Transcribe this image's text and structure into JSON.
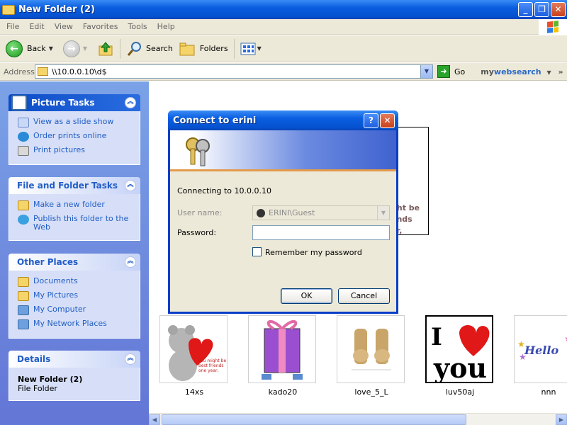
{
  "window": {
    "title": "New Folder (2)"
  },
  "menu": [
    "File",
    "Edit",
    "View",
    "Favorites",
    "Tools",
    "Help"
  ],
  "toolbar": {
    "back_label": "Back",
    "search_label": "Search",
    "folders_label": "Folders"
  },
  "address": {
    "label": "Address",
    "value": "\\\\10.0.0.10\\d$",
    "go_label": "Go",
    "websearch_prefix": "my",
    "websearch_brand": "websearch"
  },
  "left_pane": {
    "picture_tasks": {
      "title": "Picture Tasks",
      "items": [
        "View as a slide show",
        "Order prints online",
        "Print pictures"
      ]
    },
    "file_folder_tasks": {
      "title": "File and Folder Tasks",
      "items": [
        "Make a new folder",
        "Publish this folder to the Web"
      ]
    },
    "other_places": {
      "title": "Other Places",
      "items": [
        "Documents",
        "My Pictures",
        "My Computer",
        "My Network Places"
      ]
    },
    "details": {
      "title": "Details",
      "name": "New Folder (2)",
      "type": "File Folder"
    }
  },
  "files": [
    {
      "name": "14xs",
      "caption": "You might be best friends one year,"
    },
    {
      "name": "kado20"
    },
    {
      "name": "love_5_L"
    },
    {
      "name": "luv50aj"
    },
    {
      "name": "nnn",
      "caption": "Hello"
    }
  ],
  "behind_text": "ght be\nends\nar,",
  "dialog": {
    "title": "Connect to erini",
    "connecting": "Connecting to 10.0.0.10",
    "username_label": "User name:",
    "username_value": "ERINI\\Guest",
    "password_label": "Password:",
    "password_value": "",
    "remember_label": "Remember my password",
    "ok_label": "OK",
    "cancel_label": "Cancel"
  },
  "colors": {
    "title_blue": "#0a5ee0",
    "link_blue": "#215dc6",
    "pane_bg": "#6f8ade",
    "dialog_bg": "#ece9d8"
  }
}
